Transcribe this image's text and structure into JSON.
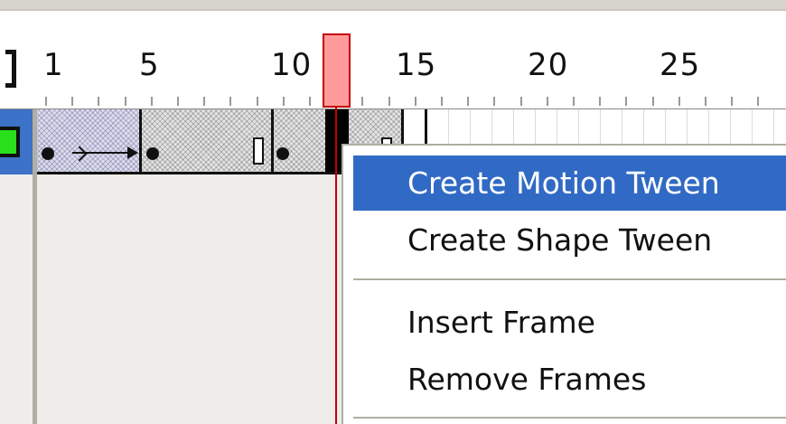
{
  "timeline": {
    "frame_numbers": [
      {
        "label": "1",
        "frame": 1
      },
      {
        "label": "5",
        "frame": 5
      },
      {
        "label": "10",
        "frame": 10
      },
      {
        "label": "15",
        "frame": 15
      },
      {
        "label": "20",
        "frame": 20
      },
      {
        "label": "25",
        "frame": 25
      }
    ],
    "current_frame": 13,
    "layer_color": "#29e01b",
    "playhead_color": "#ff9a9a",
    "selection_color": "#316ac5"
  },
  "context_menu": {
    "items": [
      {
        "label": "Create Motion Tween",
        "highlighted": true
      },
      {
        "label": "Create Shape Tween",
        "highlighted": false
      },
      {
        "label": "Insert Frame",
        "highlighted": false
      },
      {
        "label": "Remove Frames",
        "highlighted": false
      }
    ]
  }
}
